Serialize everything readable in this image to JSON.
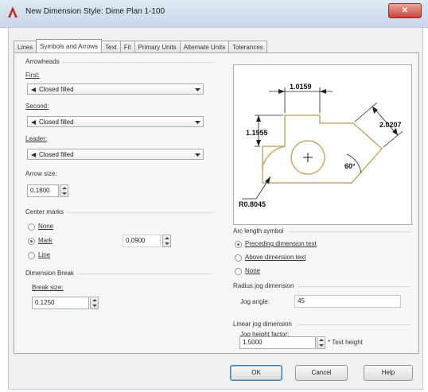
{
  "window": {
    "title": "New Dimension Style: Dime Plan 1-100",
    "close_label": "✕"
  },
  "tabs": [
    {
      "label": "Lines"
    },
    {
      "label": "Symbols and Arrows"
    },
    {
      "label": "Text"
    },
    {
      "label": "Fit"
    },
    {
      "label": "Primary Units"
    },
    {
      "label": "Alternate Units"
    },
    {
      "label": "Tolerances"
    }
  ],
  "arrowheads": {
    "heading": "Arrowheads",
    "first_label": "First:",
    "first_value": "Closed filled",
    "second_label": "Second:",
    "second_value": "Closed filled",
    "leader_label": "Leader:",
    "leader_value": "Closed filled",
    "arrow_size_label": "Arrow size:",
    "arrow_size_value": "0.1800"
  },
  "center_marks": {
    "heading": "Center marks",
    "options": [
      {
        "label": "None",
        "selected": false
      },
      {
        "label": "Mark",
        "selected": true
      },
      {
        "label": "Line",
        "selected": false
      }
    ],
    "size_value": "0.0900"
  },
  "dimension_break": {
    "heading": "Dimension Break",
    "break_size_label": "Break size:",
    "break_size_value": "0.1250"
  },
  "preview": {
    "dim_top": "1.0159",
    "dim_left": "1.1955",
    "dim_right": "2.0207",
    "dim_angle": "60°",
    "dim_radius": "R0.8045"
  },
  "arc_length_symbol": {
    "heading": "Arc length symbol",
    "options": [
      {
        "label": "Preceding dimension text",
        "selected": true
      },
      {
        "label": "Above dimension text",
        "selected": false
      },
      {
        "label": "None",
        "selected": false
      }
    ]
  },
  "radius_jog": {
    "heading": "Radius jog dimension",
    "jog_angle_label": "Jog angle:",
    "jog_angle_value": "45"
  },
  "linear_jog": {
    "heading": "Linear jog dimension",
    "jog_height_label": "Jog height factor:",
    "jog_height_value": "1.5000",
    "suffix": "* Text height"
  },
  "buttons": {
    "ok": "OK",
    "cancel": "Cancel",
    "help": "Help"
  },
  "colors": {
    "title_gradient_top": "#dfe8f3",
    "close_button": "#c7453a",
    "preview_outline": "#c8a86a",
    "dimension_lines": "#222222"
  }
}
